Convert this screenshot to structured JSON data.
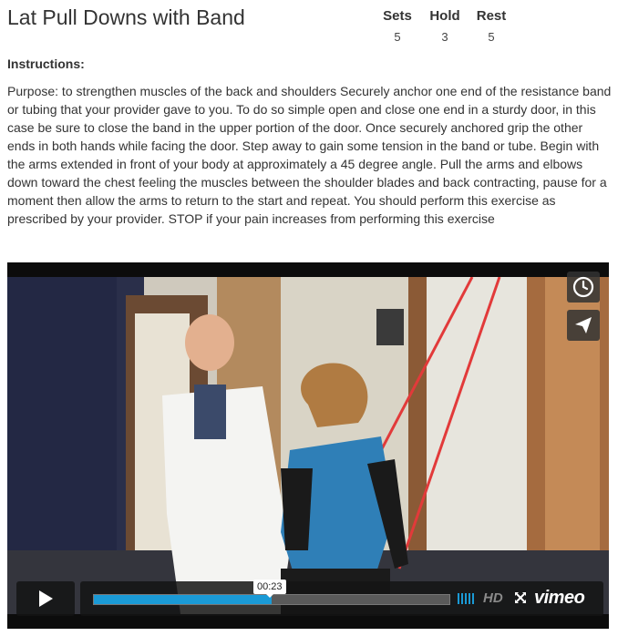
{
  "exercise": {
    "title": "Lat Pull Downs with Band",
    "stats": [
      {
        "label": "Sets",
        "value": "5"
      },
      {
        "label": "Hold",
        "value": "3"
      },
      {
        "label": "Rest",
        "value": "5"
      }
    ]
  },
  "instructions": {
    "heading": "Instructions:",
    "body": "Purpose: to strengthen muscles of the back and shoulders Securely anchor one end of the resistance band or tubing that your provider gave to you. To do so simple open and close one end in a sturdy door, in this case be sure to close the band in the upper portion of the door. Once securely anchored grip the other ends in both hands while facing the door. Step away to gain some tension in the band or tube. Begin with the arms extended in front of your body at approximately a 45 degree angle. Pull the arms and elbows down toward the chest feeling the muscles between the shoulder blades and back contracting, pause for a moment then allow the arms to return to the start and repeat. You should perform this exercise as prescribed by your provider. STOP if your pain increases from performing this exercise"
  },
  "video": {
    "current_time": "00:23",
    "progress_fraction": 0.5,
    "hd_label": "HD",
    "brand": "vimeo",
    "icons": [
      "clock-icon",
      "send-icon",
      "play-icon",
      "volume-icon",
      "fullscreen-icon"
    ],
    "accent_color": "#1a9ad6"
  }
}
